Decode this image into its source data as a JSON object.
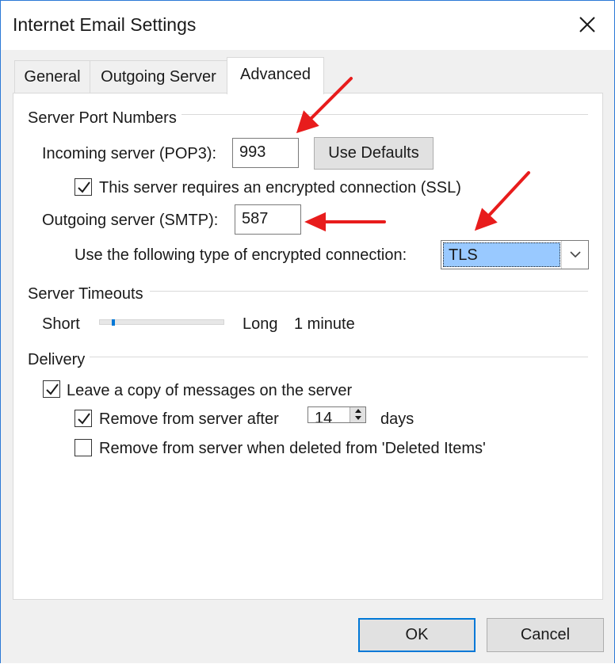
{
  "window": {
    "title": "Internet Email Settings"
  },
  "tabs": {
    "general": "General",
    "outgoing_server": "Outgoing Server",
    "advanced": "Advanced",
    "active": "Advanced"
  },
  "ports": {
    "group_title": "Server Port Numbers",
    "incoming_label": "Incoming server (POP3):",
    "incoming_value": "993",
    "use_defaults": "Use Defaults",
    "ssl_label": "This server requires an encrypted connection (SSL)",
    "ssl_checked": true,
    "outgoing_label": "Outgoing server (SMTP):",
    "outgoing_value": "587",
    "encryption_label": "Use the following type of encrypted connection:",
    "encryption_value": "TLS"
  },
  "timeouts": {
    "group_title": "Server Timeouts",
    "short_label": "Short",
    "long_label": "Long",
    "value_text": "1 minute",
    "slider_fraction": 0.1
  },
  "delivery": {
    "group_title": "Delivery",
    "leave_copy_label": "Leave a copy of messages on the server",
    "leave_copy_checked": true,
    "remove_after_label": "Remove from server after",
    "remove_after_checked": true,
    "remove_after_days": "14",
    "days_label": "days",
    "remove_deleted_label": "Remove from server when deleted from 'Deleted Items'",
    "remove_deleted_checked": false
  },
  "buttons": {
    "ok": "OK",
    "cancel": "Cancel"
  },
  "colors": {
    "accent": "#0078d7",
    "selection": "#99c9ff",
    "annotation_arrow": "#e81c1c"
  },
  "icons": {
    "close": "close-icon",
    "dropdown": "chevron-down-icon",
    "check": "checkmark-icon",
    "spin_up": "triangle-up-icon",
    "spin_down": "triangle-down-icon",
    "arrow": "red-arrow-annotation"
  }
}
